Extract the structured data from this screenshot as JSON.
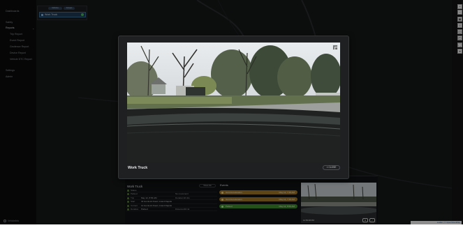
{
  "sidebar": {
    "items": [
      {
        "label": "Dashboards"
      },
      {
        "label": "Safety"
      },
      {
        "label": "Reports"
      },
      {
        "label": "Trip Report"
      },
      {
        "label": "Event Report"
      },
      {
        "label": "Geofence Report"
      },
      {
        "label": "Device Report"
      },
      {
        "label": "Vehicle DTC Report"
      },
      {
        "label": "Settings"
      },
      {
        "label": "Admin"
      }
    ],
    "brand": "Vehiclelink"
  },
  "vehicle_panel": {
    "btn_a": "Vehicles",
    "btn_b": "Groups",
    "vehicle_name": "Work Truck",
    "status_color": "#48b858"
  },
  "toolbar": {
    "icons": [
      "zoom-in-icon",
      "zoom-out-icon",
      "layers-icon",
      "traffic-icon",
      "satellite-icon",
      "measure-icon",
      "fullscreen-icon",
      "locate-icon"
    ],
    "glyphs": [
      "+",
      "−",
      "▣",
      "≡",
      "◫",
      "◰",
      "⛶",
      "⌖"
    ]
  },
  "attribution": "Leaflet | © OpenStreetMap",
  "details": {
    "title": "Work Truck",
    "share_label": "Share link",
    "rows": [
      {
        "k": "Status",
        "v": "",
        "k2": "",
        "v2": ""
      },
      {
        "k": "Parked",
        "v": "",
        "k2": "No movement",
        "v2": ""
      },
      {
        "k": "Trip",
        "v": "May 12, 8:56 AM",
        "k2": "Duration",
        "v2": "1h 4m"
      },
      {
        "k": "Start",
        "v": "32 Hemlock Road, Grand Rapids",
        "k2": "",
        "v2": ""
      },
      {
        "k": "Current",
        "v": "14 Hemlock Road, Grand Rapids",
        "k2": "",
        "v2": ""
      },
      {
        "k": "Duration",
        "v": "Parked",
        "k2": "Distance",
        "v2": "0.0 mi"
      }
    ],
    "events_title": "Events",
    "events": [
      {
        "label": "Hard Acceleration",
        "time": "May 12, 7:48 AM",
        "tone": "amber"
      },
      {
        "label": "Hard Acceleration",
        "time": "May 12, 7:48 AM",
        "tone": "amber"
      },
      {
        "label": "Parked",
        "time": "May 12, 8:56 AM",
        "tone": "green"
      }
    ],
    "thumb_caption": "12:56:08 PM"
  },
  "modal": {
    "title": "Work Truck",
    "close_label": "CLOSE"
  },
  "colors": {
    "accent": "#3f6f96",
    "event_amber": "#a0782a",
    "event_green": "#3f8a2c"
  }
}
